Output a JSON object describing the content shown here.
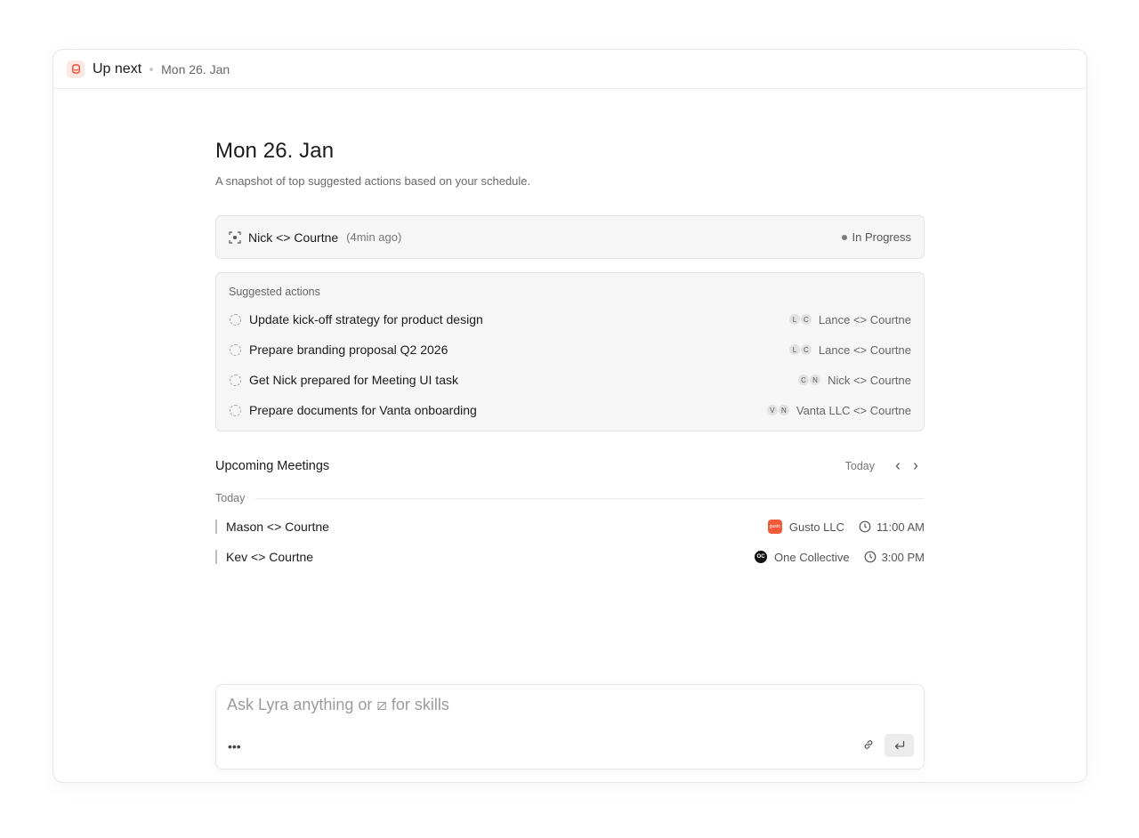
{
  "topbar": {
    "title": "Up next",
    "date": "Mon 26. Jan"
  },
  "header": {
    "title": "Mon 26. Jan",
    "subtitle": "A snapshot of top suggested actions based on your schedule."
  },
  "current_meeting": {
    "name": "Nick <> Courtne",
    "ago": "(4min ago)",
    "status": "In Progress"
  },
  "suggested": {
    "header": "Suggested actions",
    "items": [
      {
        "text": "Update kick-off strategy for product design",
        "avatars": [
          "L",
          "C"
        ],
        "meeting": "Lance <> Courtne"
      },
      {
        "text": "Prepare branding proposal Q2 2026",
        "avatars": [
          "L",
          "C"
        ],
        "meeting": "Lance <> Courtne"
      },
      {
        "text": "Get Nick prepared for Meeting UI task",
        "avatars": [
          "C",
          "N"
        ],
        "meeting": "Nick <> Courtne"
      },
      {
        "text": "Prepare documents for Vanta onboarding",
        "avatars": [
          "V",
          "N"
        ],
        "meeting": "Vanta LLC <> Courtne"
      }
    ]
  },
  "upcoming": {
    "title": "Upcoming Meetings",
    "today_label": "Today",
    "day_label": "Today",
    "meetings": [
      {
        "name": "Mason <> Courtne",
        "company": "Gusto LLC",
        "logo_text": "gusto",
        "logo_color": "#f05a3a",
        "time": "11:00 AM"
      },
      {
        "name": "Kev <> Courtne",
        "company": "One Collective",
        "logo_text": "OC",
        "logo_color": "#111111",
        "time": "3:00 PM"
      }
    ]
  },
  "composer": {
    "placeholder": "Ask Lyra anything or ⧄ for skills",
    "more_label": "•••"
  },
  "colors": {
    "brand": "#e8543b",
    "status_dot": "#7b7b7b"
  }
}
